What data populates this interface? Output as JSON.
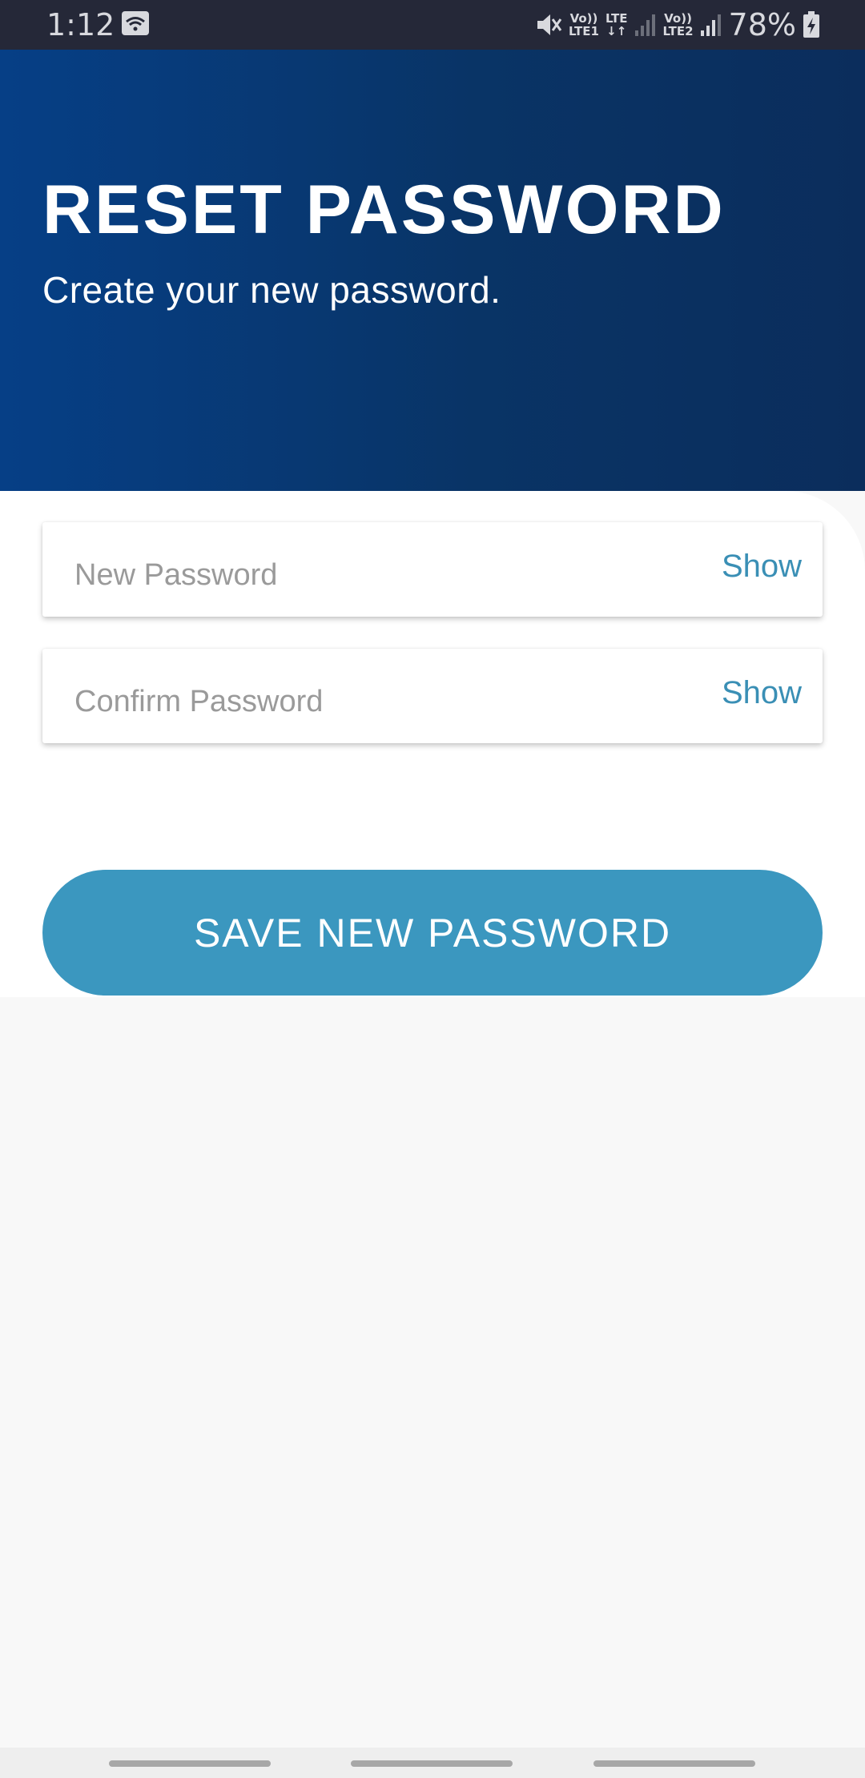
{
  "status_bar": {
    "time": "1:12",
    "sim1_label_top": "Vo))",
    "sim1_label_bottom": "LTE1",
    "lte_label_top": "LTE",
    "lte_label_bottom": "↓↑",
    "sim2_label_top": "Vo))",
    "sim2_label_bottom": "LTE2",
    "battery_percent": "78%",
    "icons": [
      "wifi-icon",
      "mute-icon",
      "signal-icon",
      "battery-charging-icon"
    ]
  },
  "header": {
    "title": "RESET PASSWORD",
    "subtitle": "Create your new password."
  },
  "form": {
    "new_password": {
      "placeholder": "New Password",
      "value": "",
      "toggle_label": "Show"
    },
    "confirm_password": {
      "placeholder": "Confirm Password",
      "value": "",
      "toggle_label": "Show"
    },
    "save_label": "SAVE NEW PASSWORD"
  },
  "colors": {
    "header_gradient_start": "#063f86",
    "header_gradient_end": "#0b2d5c",
    "accent": "#3b97bf",
    "toggle_text": "#3a8fb5",
    "status_bar_bg": "#252838"
  }
}
